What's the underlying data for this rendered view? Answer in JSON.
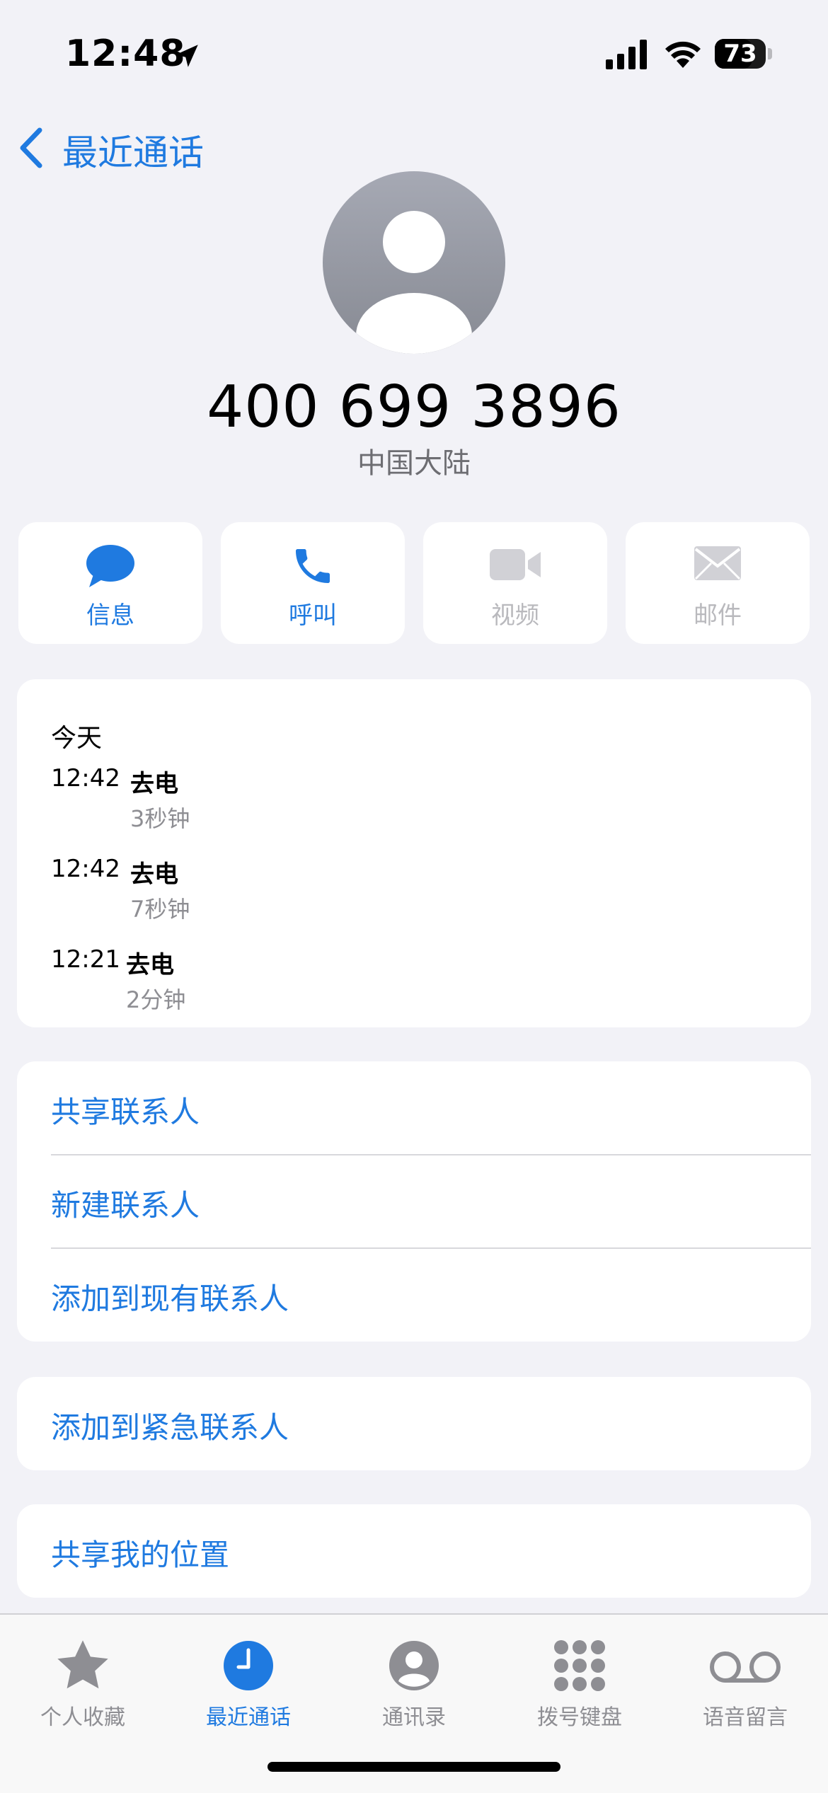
{
  "status": {
    "time": "12:48",
    "battery": "73",
    "battery_level": 0.73
  },
  "nav": {
    "back_label": "最近通话"
  },
  "contact": {
    "number": "400 699 3896",
    "region": "中国大陆"
  },
  "actions": [
    {
      "label": "信息",
      "icon": "message-icon",
      "enabled": true
    },
    {
      "label": "呼叫",
      "icon": "phone-icon",
      "enabled": true
    },
    {
      "label": "视频",
      "icon": "video-icon",
      "enabled": false
    },
    {
      "label": "邮件",
      "icon": "mail-icon",
      "enabled": false
    }
  ],
  "recents": {
    "day": "今天",
    "calls": [
      {
        "time": "12:42",
        "type": "去电",
        "duration": "3秒钟"
      },
      {
        "time": "12:42",
        "type": "去电",
        "duration": "7秒钟"
      },
      {
        "time": "12:21",
        "type": "去电",
        "duration": "2分钟"
      }
    ]
  },
  "menu_group1": [
    "共享联系人",
    "新建联系人",
    "添加到现有联系人"
  ],
  "menu_group2": [
    "添加到紧急联系人"
  ],
  "menu_group3": [
    "共享我的位置"
  ],
  "tabs": [
    {
      "label": "个人收藏",
      "icon": "star-icon",
      "active": false
    },
    {
      "label": "最近通话",
      "icon": "clock-icon",
      "active": true
    },
    {
      "label": "通讯录",
      "icon": "person-circle-icon",
      "active": false
    },
    {
      "label": "拨号键盘",
      "icon": "keypad-icon",
      "active": false
    },
    {
      "label": "语音留言",
      "icon": "voicemail-icon",
      "active": false
    }
  ],
  "colors": {
    "accent": "#1f7ae0",
    "background": "#f2f2f7",
    "disabled": "#b9b9bd"
  }
}
